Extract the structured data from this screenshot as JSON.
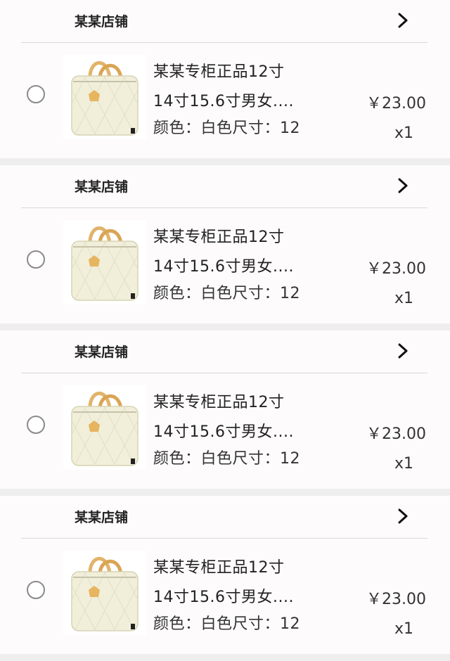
{
  "cart": {
    "items": [
      {
        "shop": "某某店铺",
        "title_line1": "某某专柜正品12寸",
        "title_line2": "14寸15.6寸男女....",
        "spec": "颜色：白色尺寸：12",
        "price": "￥23.00",
        "qty": "x1"
      },
      {
        "shop": "某某店铺",
        "title_line1": "某某专柜正品12寸",
        "title_line2": "14寸15.6寸男女....",
        "spec": "颜色：白色尺寸：12",
        "price": "￥23.00",
        "qty": "x1"
      },
      {
        "shop": "某某店铺",
        "title_line1": "某某专柜正品12寸",
        "title_line2": "14寸15.6寸男女....",
        "spec": "颜色：白色尺寸：12",
        "price": "￥23.00",
        "qty": "x1"
      },
      {
        "shop": "某某店铺",
        "title_line1": "某某专柜正品12寸",
        "title_line2": "14寸15.6寸男女....",
        "spec": "颜色：白色尺寸：12",
        "price": "￥23.00",
        "qty": "x1"
      }
    ]
  },
  "icons": {
    "shop_arrow": "chevron-right-icon",
    "select": "radio-unchecked-icon",
    "product_image": "handbag-image"
  },
  "colors": {
    "background": "#eeeeee",
    "card": "#fdfbfb",
    "divider": "#d8d8d8",
    "text": "#222222"
  }
}
